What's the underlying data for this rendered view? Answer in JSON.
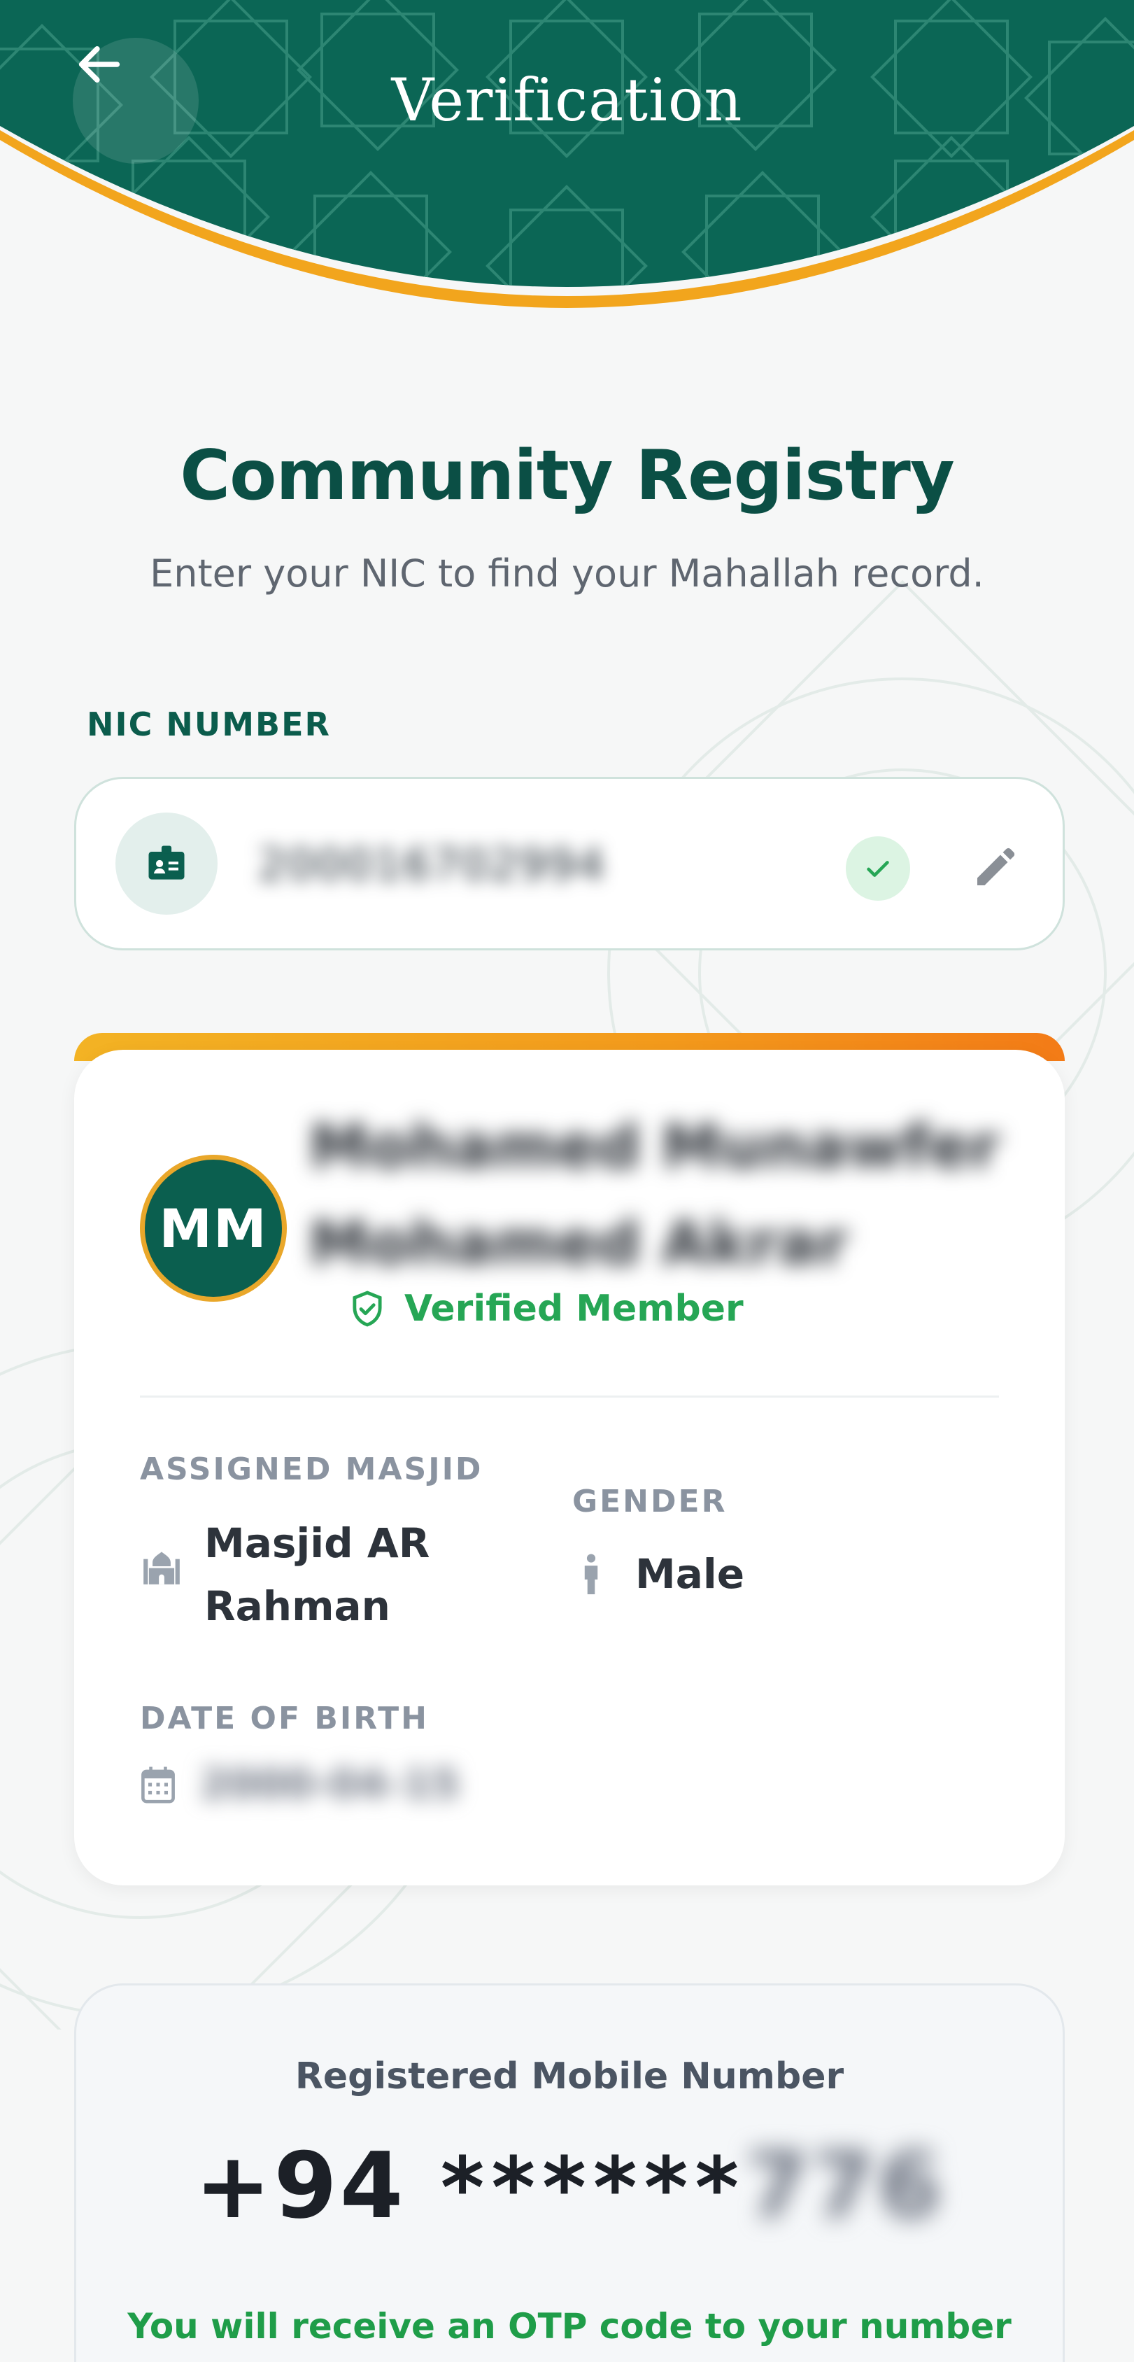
{
  "header": {
    "title": "Verification",
    "back_icon": "arrow-left-icon"
  },
  "intro": {
    "headline": "Community Registry",
    "subhead": "Enter your NIC to find your Mahallah record."
  },
  "nic": {
    "label": "NIC NUMBER",
    "value": "200016702994",
    "icon": "id-card-icon",
    "status_icon": "check-icon",
    "edit_icon": "pencil-icon"
  },
  "member": {
    "initials": "MM",
    "name_line1": "Mohamed Munawfer",
    "name_line2": "Mohamed Akrar",
    "verified_label": "Verified Member",
    "assigned_masjid_label": "ASSIGNED MASJID",
    "assigned_masjid_line1": "Masjid AR",
    "assigned_masjid_line2": "Rahman",
    "gender_label": "GENDER",
    "gender_value": "Male",
    "dob_label": "DATE OF BIRTH",
    "dob_value": "2000-04-15"
  },
  "mobile": {
    "label": "Registered Mobile Number",
    "country_code": "+94",
    "masked": "******",
    "tail": "776",
    "otp_note": "You will receive an OTP code to your number"
  },
  "colors": {
    "brand_green": "#0b5f4f",
    "accent_orange": "#f39a1c",
    "success_green": "#26a655"
  }
}
